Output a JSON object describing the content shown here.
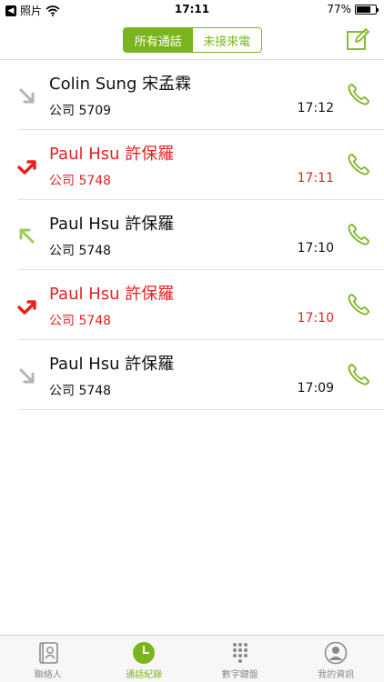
{
  "status_bar": {
    "back_app": "照片",
    "time": "17:11",
    "battery": "77%",
    "battery_level": 0.77
  },
  "header": {
    "segments": [
      "所有通話",
      "未接來電"
    ],
    "active_segment": 0
  },
  "calls": [
    {
      "name": "Colin Sung 宋孟霖",
      "ext": "公司 5709",
      "time": "17:12",
      "direction": "incoming",
      "missed": false
    },
    {
      "name": "Paul Hsu 許保羅",
      "ext": "公司 5748",
      "time": "17:11",
      "direction": "missed",
      "missed": true
    },
    {
      "name": "Paul Hsu 許保羅",
      "ext": "公司 5748",
      "time": "17:10",
      "direction": "outgoing",
      "missed": false
    },
    {
      "name": "Paul Hsu 許保羅",
      "ext": "公司 5748",
      "time": "17:10",
      "direction": "missed",
      "missed": true
    },
    {
      "name": "Paul Hsu 許保羅",
      "ext": "公司 5748",
      "time": "17:09",
      "direction": "incoming",
      "missed": false
    }
  ],
  "tabs": [
    {
      "label": "聯絡人",
      "icon": "contacts-icon",
      "active": false
    },
    {
      "label": "通話紀錄",
      "icon": "clock-icon",
      "active": true
    },
    {
      "label": "數字鍵盤",
      "icon": "keypad-icon",
      "active": false
    },
    {
      "label": "我的資訊",
      "icon": "profile-icon",
      "active": false
    }
  ],
  "colors": {
    "accent": "#7ab51d",
    "missed": "#e52222",
    "incoming_arrow": "#b5b5b5",
    "outgoing_arrow": "#9ccc5a"
  }
}
